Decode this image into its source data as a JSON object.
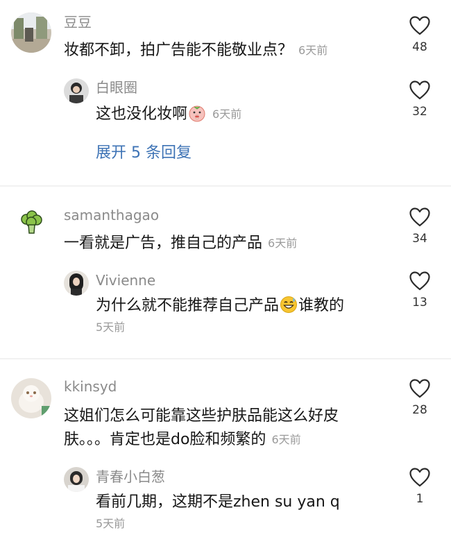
{
  "comments": [
    {
      "username": "豆豆",
      "text": "妆都不卸，拍广告能不能敬业点？",
      "time": "6天前",
      "likes": "48",
      "replies": [
        {
          "username": "白眼圈",
          "text": "这也没化妆啊",
          "emoji": "shushing-face-emoji",
          "time": "6天前",
          "likes": "32"
        }
      ],
      "expand_label": "展开 5 条回复"
    },
    {
      "username": "samanthagao",
      "text": "一看就是广告，推自己的产品",
      "time": "6天前",
      "likes": "34",
      "replies": [
        {
          "username": "Vivienne",
          "text_before": "为什么就不能推荐自己产品",
          "emoji": "grinning-sweat-emoji",
          "text_after": "谁教的",
          "time": "5天前",
          "likes": "13"
        }
      ]
    },
    {
      "username": "kkinsyd",
      "text_line1": "这姐们怎么可能靠这些护肤品能这么好皮",
      "text_line2": "肤。。。肯定也是do脸和频繁的",
      "time": "6天前",
      "likes": "28",
      "replies": [
        {
          "username": "青春小白葱",
          "text": "看前几期，这期不是zhen su yan q",
          "time": "5天前",
          "likes": "1"
        }
      ]
    }
  ],
  "icons": {
    "like": "heart-outline-icon"
  }
}
